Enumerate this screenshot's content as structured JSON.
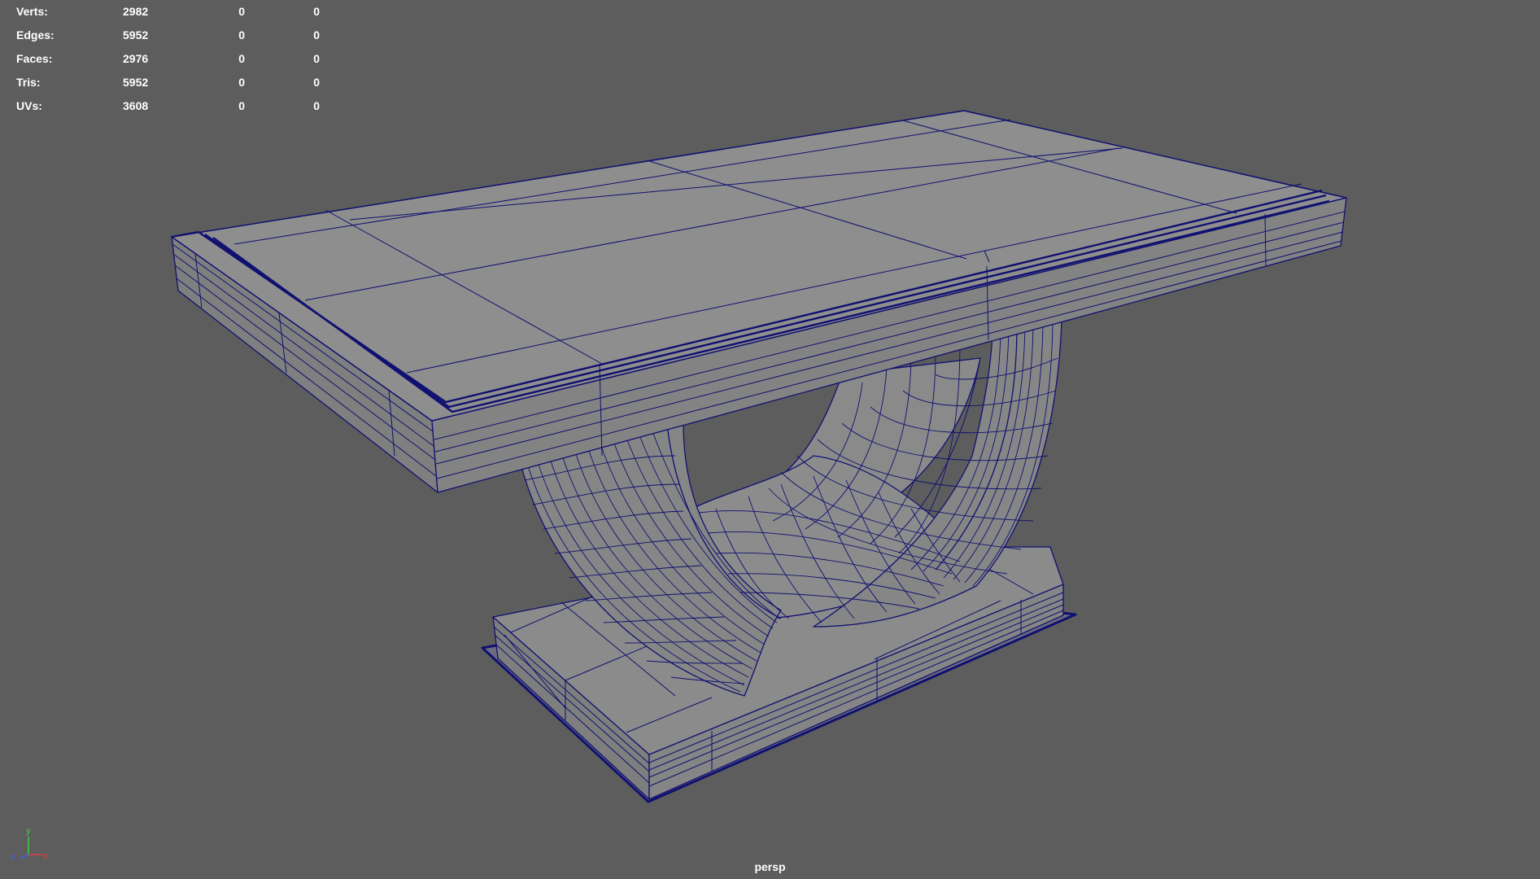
{
  "hud": {
    "rows": [
      {
        "label": "Verts:",
        "total": "2982",
        "selected": "0",
        "triangulated": "0"
      },
      {
        "label": "Edges:",
        "total": "5952",
        "selected": "0",
        "triangulated": "0"
      },
      {
        "label": "Faces:",
        "total": "2976",
        "selected": "0",
        "triangulated": "0"
      },
      {
        "label": "Tris:",
        "total": "5952",
        "selected": "0",
        "triangulated": "0"
      },
      {
        "label": "UVs:",
        "total": "3608",
        "selected": "0",
        "triangulated": "0"
      }
    ]
  },
  "viewport": {
    "camera": "persp",
    "background": "#5d5d5d",
    "wire_color": "#101070",
    "surface_color": "#8b8b8b"
  },
  "axis_gizmo": {
    "y": "y",
    "x": "x",
    "z": "z"
  }
}
